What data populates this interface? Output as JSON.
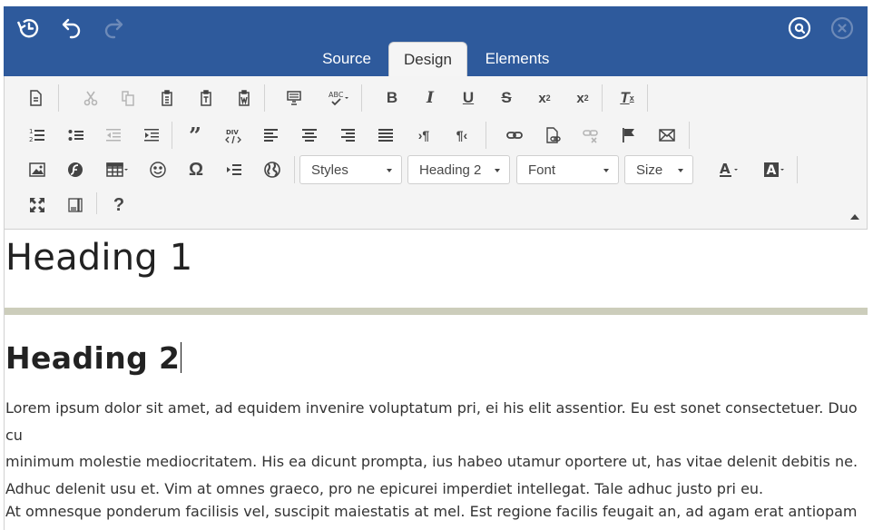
{
  "tabs": {
    "source": "Source",
    "design": "Design",
    "elements": "Elements"
  },
  "topbar_icons": [
    "history-icon",
    "undo-icon",
    "redo-icon",
    "search-icon",
    "close-icon"
  ],
  "toolbar": {
    "styles_label": "Styles",
    "format_label": "Heading 2",
    "font_label": "Font",
    "size_label": "Size",
    "help_label": "?"
  },
  "editor": {
    "heading1": "Heading 1",
    "heading2": "Heading 2",
    "paragraph1_lines": [
      "Lorem ipsum dolor sit amet, ad equidem invenire voluptatum pri, ei his elit assentior. Eu est sonet consectetuer. Duo cu",
      "minimum molestie mediocritatem. His ea dicunt prompta, ius habeo utamur oportere ut, has vitae delenit debitis ne.",
      "Adhuc delenit usu et. Vim at omnes graeco, pro ne epicurei imperdiet intellegat. Tale adhuc justo pri eu."
    ],
    "paragraph2_lines": [
      "At omnesque ponderum facilisis vel, suscipit maiestatis at mel. Est regione facilis feugait an, ad agam erat antiopam vel."
    ]
  },
  "colors": {
    "topbar": "#2e5a9c",
    "toolbar_bg": "#f4f4f4",
    "divider": "#cccdbb"
  }
}
